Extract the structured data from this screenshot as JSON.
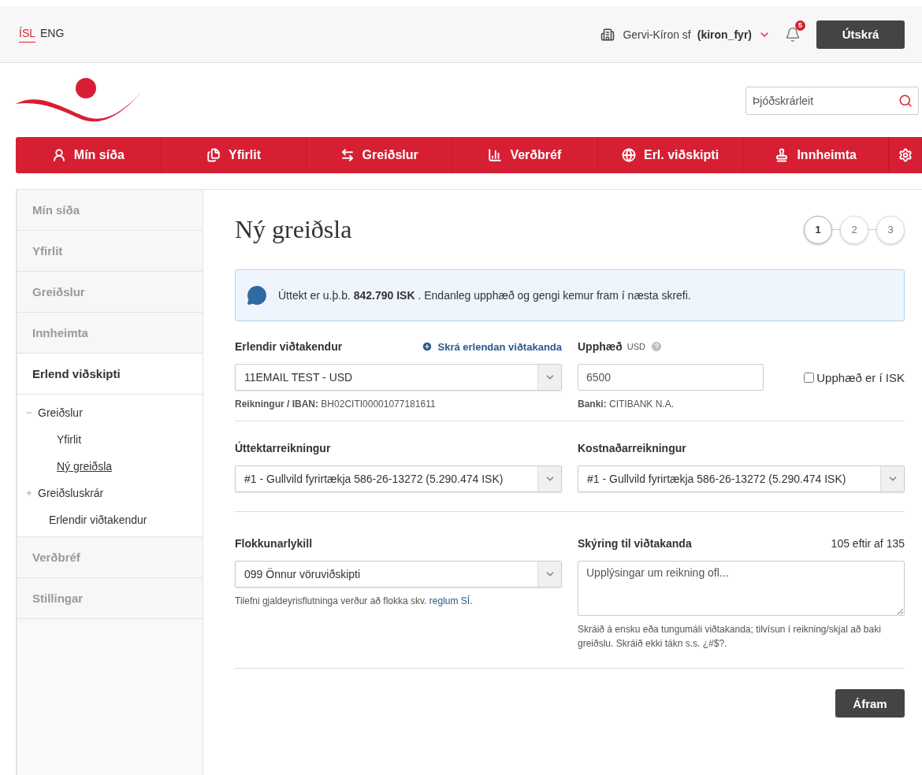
{
  "top_bar": {
    "languages": [
      {
        "label": "ÍSL",
        "selected": true
      },
      {
        "label": "ENG",
        "selected": false
      }
    ],
    "company": "Gervi-Kíron sf",
    "username": "(kiron_fyr)",
    "notification_count": "5",
    "logout_button": "Útskrá"
  },
  "search": {
    "placeholder": "Þjóðskrárleit"
  },
  "nav": [
    {
      "kind": "user",
      "label": "Mín síða"
    },
    {
      "kind": "documents",
      "label": "Yfirlit"
    },
    {
      "kind": "transfer",
      "label": "Greiðslur"
    },
    {
      "kind": "chart",
      "label": "Verðbréf"
    },
    {
      "kind": "globe",
      "label": "Erl. viðskipti"
    },
    {
      "kind": "stamp",
      "label": "Innheimta"
    },
    {
      "kind": "settings"
    }
  ],
  "sidebar": [
    {
      "label": "Mín síða",
      "selected": false
    },
    {
      "label": "Yfirlit",
      "selected": false
    },
    {
      "label": "Greiðslur",
      "selected": false
    },
    {
      "label": "Innheimta",
      "selected": false
    },
    {
      "label": "Erlend viðskipti",
      "selected": true,
      "children": [
        {
          "label": "Greiðslur",
          "selected": false,
          "expanded": true,
          "children": [
            {
              "label": "Yfirlit",
              "selected": false
            },
            {
              "label": "Ný greiðsla",
              "selected": true
            }
          ]
        },
        {
          "label": "Greiðsluskrár",
          "selected": false,
          "expanded": false
        },
        {
          "label": "Erlendir viðtakendur",
          "selected": false
        }
      ]
    },
    {
      "label": "Verðbréf",
      "selected": false
    },
    {
      "label": "Stillingar",
      "selected": false
    }
  ],
  "page_title": "Ný greiðsla",
  "steps": [
    {
      "label": "1",
      "selected": true
    },
    {
      "label": "2",
      "selected": false
    },
    {
      "label": "3",
      "selected": false
    }
  ],
  "info": "Úttekt er u.þ.b. **842.790 ISK** . Endanleg upphæð og gengi kemur fram í næsta skrefi.",
  "recipient": {
    "label": "Erlendir viðtakendur",
    "add_link": "Skrá erlendan viðtakanda",
    "value": "11EMAIL TEST - USD",
    "iban_label": "Reikningur / IBAN:",
    "iban": "BH02CITI00001077181611"
  },
  "amount": {
    "label": "Upphæð",
    "currency": "USD",
    "value": "6500",
    "isk_checkbox": {
      "label": "Upphæð er í ISK",
      "checked": false
    },
    "bank_label": "Banki:",
    "bank": "CITIBANK N.A."
  },
  "withdrawal_account": {
    "label": "Úttektarreikningur",
    "value": "#1 - Gullvild fyrirtækja 586-26-13272 (5.290.474 ISK)"
  },
  "cost_account": {
    "label": "Kostnaðarreikningur",
    "value": "#1 - Gullvild fyrirtækja 586-26-13272 (5.290.474 ISK)"
  },
  "category": {
    "label": "Flokkunarlykill",
    "value": "099 Önnur vöruviðskipti",
    "note": "Tilefni gjaldeyrisflutninga verður að flokka skv.",
    "note_link": "reglum SÍ",
    "note_end": "."
  },
  "description": {
    "label": "Skýring til viðtakanda",
    "counter": "105 eftir af 135",
    "value": "Upplýsingar um reikning ofl...",
    "hint": "Skráið á ensku eða tungumáli viðtakanda; tilvísun í reikning/skjal að baki greiðslu. Skráið ekki tákn s.s. ¿#$?."
  },
  "continue_button": "Áfram"
}
